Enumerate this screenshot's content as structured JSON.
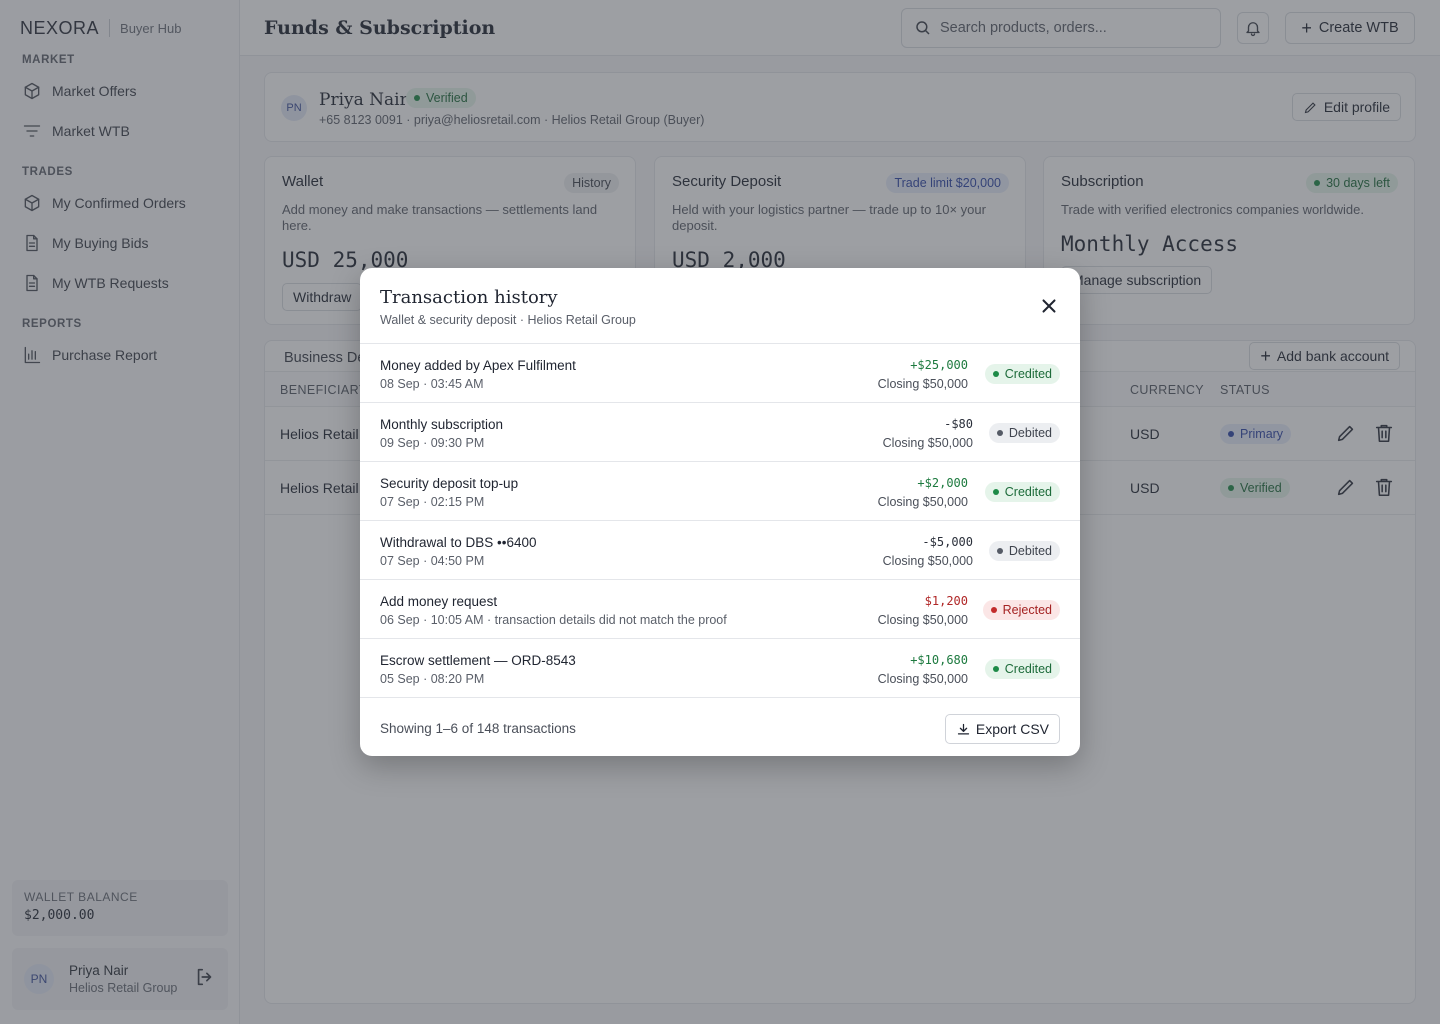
{
  "brand": {
    "name": "NEXORA",
    "sub": "Buyer Hub"
  },
  "sidebar": {
    "sections": [
      {
        "title": "MARKET",
        "items": [
          {
            "label": "Market Offers",
            "icon": "cube-icon"
          },
          {
            "label": "Market WTB",
            "icon": "filter-icon"
          }
        ]
      },
      {
        "title": "TRADES",
        "items": [
          {
            "label": "My Confirmed Orders",
            "icon": "cube-icon"
          },
          {
            "label": "My Buying Bids",
            "icon": "document-icon"
          },
          {
            "label": "My WTB Requests",
            "icon": "document-icon"
          }
        ]
      },
      {
        "title": "REPORTS",
        "items": [
          {
            "label": "Purchase Report",
            "icon": "bar-chart-icon"
          }
        ]
      }
    ],
    "wallet": {
      "label": "WALLET BALANCE",
      "value": "$2,000.00"
    },
    "user": {
      "initials": "PN",
      "name": "Priya Nair",
      "org": "Helios Retail Group"
    }
  },
  "header": {
    "title": "Funds & Subscription",
    "search_placeholder": "Search products, orders...",
    "create_label": "Create WTB"
  },
  "profile": {
    "initials": "PN",
    "name": "Priya Nair",
    "badge": "Verified",
    "meta": "+65 8123 0091 · priya@heliosretail.com · Helios Retail Group (Buyer)",
    "edit_label": "Edit profile"
  },
  "funds": {
    "wallet": {
      "title": "Wallet",
      "tag": "History",
      "desc": "Add money and make transactions — settlements land here.",
      "amount": "USD 25,000",
      "button": "Withdraw"
    },
    "deposit": {
      "title": "Security Deposit",
      "tag": "Trade limit $20,000",
      "desc": "Held with your logistics partner — trade up to 10× your deposit.",
      "amount": "USD 2,000"
    },
    "subscription": {
      "title": "Subscription",
      "tag": "30 days left",
      "desc": "Trade with verified electronics companies worldwide.",
      "amount": "Monthly Access",
      "button": "Manage subscription"
    }
  },
  "bank": {
    "title": "Business De",
    "add_label": "Add bank account",
    "columns": {
      "beneficiary": "BENEFICIARY",
      "currency": "CURRENCY",
      "status": "STATUS"
    },
    "rows": [
      {
        "beneficiary": "Helios Retail",
        "currency": "USD",
        "status": "Primary"
      },
      {
        "beneficiary": "Helios Retail",
        "currency": "USD",
        "status": "Verified"
      }
    ]
  },
  "modal": {
    "title": "Transaction history",
    "subtitle": "Wallet & security deposit · Helios Retail Group",
    "transactions": [
      {
        "name": "Money added by Apex Fulfilment",
        "date": "08 Sep · 03:45 AM",
        "amount": "+$25,000",
        "closing": "Closing $50,000",
        "status": "Credited"
      },
      {
        "name": "Monthly subscription",
        "date": "09 Sep · 09:30 PM",
        "amount": "-$80",
        "closing": "Closing $50,000",
        "status": "Debited"
      },
      {
        "name": "Security deposit top-up",
        "date": "07 Sep · 02:15 PM",
        "amount": "+$2,000",
        "closing": "Closing $50,000",
        "status": "Credited"
      },
      {
        "name": "Withdrawal to DBS ••6400",
        "date": "07 Sep · 04:50 PM",
        "amount": "-$5,000",
        "closing": "Closing $50,000",
        "status": "Debited"
      },
      {
        "name": "Add money request",
        "date": "06 Sep · 10:05 AM · transaction details did not match the proof",
        "amount": "$1,200",
        "closing": "Closing $50,000",
        "status": "Rejected"
      },
      {
        "name": "Escrow settlement — ORD-8543",
        "date": "05 Sep · 08:20 PM",
        "amount": "+$10,680",
        "closing": "Closing $50,000",
        "status": "Credited"
      }
    ],
    "footer_text": "Showing 1–6 of 148 transactions",
    "export_label": "Export CSV"
  },
  "colors": {
    "credited": "#1d7a3f",
    "rejected": "#b02727",
    "accent": "#2f47a8"
  }
}
